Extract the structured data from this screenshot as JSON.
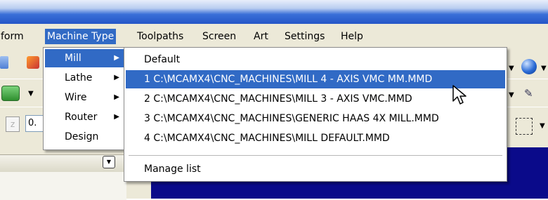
{
  "menubar": {
    "items": [
      "form",
      "Machine Type",
      "Toolpaths",
      "Screen",
      "Art",
      "Settings",
      "Help"
    ]
  },
  "toolbar": {
    "numeric_field": "0."
  },
  "machine_menu": {
    "items": [
      {
        "label": "Mill",
        "has_submenu": true
      },
      {
        "label": "Lathe",
        "has_submenu": true
      },
      {
        "label": "Wire",
        "has_submenu": true
      },
      {
        "label": "Router",
        "has_submenu": true
      },
      {
        "label": "Design",
        "has_submenu": false
      }
    ]
  },
  "mill_submenu": {
    "items": [
      "Default",
      "1  C:\\MCAMX4\\CNC_MACHINES\\MILL 4 - AXIS VMC MM.MMD",
      "2  C:\\MCAMX4\\CNC_MACHINES\\MILL 3 - AXIS VMC.MMD",
      "3  C:\\MCAMX4\\CNC_MACHINES\\GENERIC HAAS 4X MILL.MMD",
      "4  C:\\MCAMX4\\CNC_MACHINES\\MILL DEFAULT.MMD"
    ],
    "manage": "Manage list"
  },
  "colors": {
    "highlight": "#316ac5",
    "menubar_bg": "#ece9d8",
    "viewport": "#0a0a8a"
  },
  "icons": [
    "blue-arrow-icon",
    "orange-tool-icon",
    "green-shape-icon",
    "zoom-icon",
    "sphere-icon",
    "pen-icon",
    "dashed-select-icon",
    "dropdown-arrow-icon",
    "mouse-pointer-icon",
    "submenu-arrow-icon"
  ]
}
